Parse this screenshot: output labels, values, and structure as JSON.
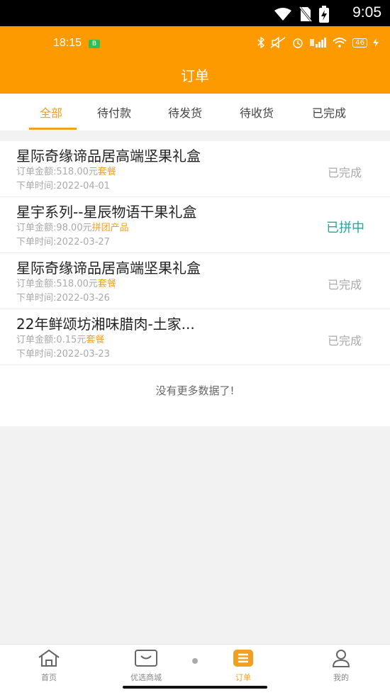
{
  "system_status": {
    "time": "9:05"
  },
  "app_status": {
    "time": "18:15",
    "badge": "B",
    "battery": "46"
  },
  "header": {
    "title": "订单"
  },
  "tabs": [
    {
      "label": "全部",
      "active": true
    },
    {
      "label": "待付款"
    },
    {
      "label": "待发货"
    },
    {
      "label": "待收货"
    },
    {
      "label": "已完成"
    }
  ],
  "orders": [
    {
      "name": "星际奇缘谛品居高端坚果礼盒",
      "amount": "订单金额:518.00元",
      "tag": "套餐",
      "date": "下单时间:2022-04-01",
      "status": "已完成"
    },
    {
      "name": "星宇系列--星辰物语干果礼盒",
      "amount": "订单金额:98.00元",
      "tag": "拼团产品",
      "date": "下单时间:2022-03-27",
      "status": "已拼中"
    },
    {
      "name": "星际奇缘谛品居高端坚果礼盒",
      "amount": "订单金额:518.00元",
      "tag": "套餐",
      "date": "下单时间:2022-03-26",
      "status": "已完成"
    },
    {
      "name": "22年鲜颂坊湘味腊肉-土家...",
      "amount": "订单金额:0.15元",
      "tag": "套餐",
      "date": "下单时间:2022-03-23",
      "status": "已完成"
    }
  ],
  "list_end_text": "没有更多数据了!",
  "bottom_nav": [
    {
      "label": "首页",
      "icon": "home-icon"
    },
    {
      "label": "优选商城",
      "icon": "mall-icon"
    },
    {
      "label": "订单",
      "icon": "order-list-icon",
      "active": true
    },
    {
      "label": "我的",
      "icon": "profile-icon"
    }
  ],
  "colors": {
    "primary": "#fd9a00",
    "accent": "#f0a020",
    "teal": "#1dab9e"
  }
}
